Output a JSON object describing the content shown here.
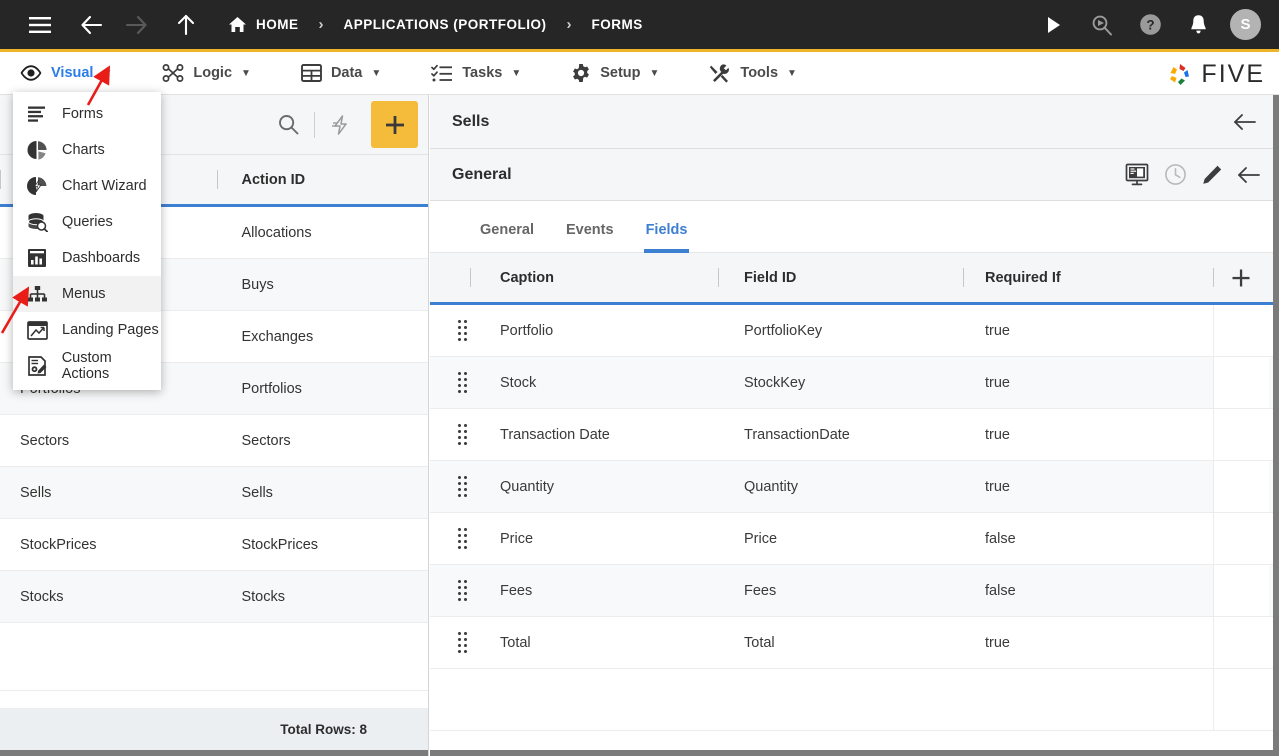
{
  "topbar": {
    "menu_icon": "hamburger-icon",
    "back_icon": "arrow-left-icon",
    "forward_icon": "arrow-right-icon",
    "up_icon": "arrow-up-icon",
    "breadcrumbs": [
      {
        "label": "HOME",
        "icon": "home-icon"
      },
      {
        "label": "APPLICATIONS (PORTFOLIO)",
        "icon": ""
      },
      {
        "label": "FORMS",
        "icon": ""
      }
    ],
    "separator": "›",
    "actions": [
      {
        "name": "run-icon",
        "label": ""
      },
      {
        "name": "search-run-icon",
        "label": ""
      },
      {
        "name": "help-icon",
        "label": ""
      },
      {
        "name": "notifications-bell-icon",
        "label": ""
      }
    ],
    "avatar_initial": "S"
  },
  "menubar": {
    "items": [
      {
        "label": "Visual",
        "icon": "eye-icon",
        "active": true
      },
      {
        "label": "Logic",
        "icon": "nodes-icon",
        "active": false
      },
      {
        "label": "Data",
        "icon": "table-icon",
        "active": false
      },
      {
        "label": "Tasks",
        "icon": "checklist-icon",
        "active": false
      },
      {
        "label": "Setup",
        "icon": "gear-icon",
        "active": false
      },
      {
        "label": "Tools",
        "icon": "tools-icon",
        "active": false
      }
    ],
    "caret": "▼",
    "logo_text": "FIVE"
  },
  "dropdown": {
    "open_for": "Visual",
    "items": [
      {
        "label": "Forms",
        "icon": "forms-icon",
        "hovered": false
      },
      {
        "label": "Charts",
        "icon": "pie-chart-icon",
        "hovered": false
      },
      {
        "label": "Chart Wizard",
        "icon": "chart-wizard-icon",
        "hovered": false
      },
      {
        "label": "Queries",
        "icon": "database-search-icon",
        "hovered": false
      },
      {
        "label": "Dashboards",
        "icon": "dashboard-icon",
        "hovered": false
      },
      {
        "label": "Menus",
        "icon": "sitemap-icon",
        "hovered": true
      },
      {
        "label": "Landing Pages",
        "icon": "landing-page-icon",
        "hovered": false
      },
      {
        "label": "Custom Actions",
        "icon": "custom-action-icon",
        "hovered": false
      }
    ]
  },
  "left_panel": {
    "toolbar": {
      "search_icon": "search-icon",
      "lightning_icon": "lightning-icon",
      "add_label": "+"
    },
    "columns": [
      "",
      "Action ID"
    ],
    "rows": [
      {
        "name": "",
        "action_id": "Allocations"
      },
      {
        "name": "",
        "action_id": "Buys"
      },
      {
        "name": "",
        "action_id": "Exchanges"
      },
      {
        "name": "Portfolios",
        "action_id": "Portfolios"
      },
      {
        "name": "Sectors",
        "action_id": "Sectors"
      },
      {
        "name": "Sells",
        "action_id": "Sells"
      },
      {
        "name": "StockPrices",
        "action_id": "StockPrices"
      },
      {
        "name": "Stocks",
        "action_id": "Stocks"
      }
    ],
    "footer": "Total Rows: 8"
  },
  "right_panel": {
    "title": "Sells",
    "back_icon": "arrow-left-icon",
    "section_title": "General",
    "section_icons": [
      {
        "name": "form-designer-icon"
      },
      {
        "name": "history-clock-icon"
      },
      {
        "name": "edit-pencil-icon"
      },
      {
        "name": "arrow-left-icon"
      }
    ],
    "tabs": [
      {
        "label": "General",
        "active": false
      },
      {
        "label": "Events",
        "active": false
      },
      {
        "label": "Fields",
        "active": true
      }
    ],
    "table": {
      "columns": [
        "",
        "Caption",
        "Field ID",
        "Required If",
        "+"
      ],
      "add_icon": "plus-icon",
      "rows": [
        {
          "caption": "Portfolio",
          "field_id": "PortfolioKey",
          "required_if": "true"
        },
        {
          "caption": "Stock",
          "field_id": "StockKey",
          "required_if": "true"
        },
        {
          "caption": "Transaction Date",
          "field_id": "TransactionDate",
          "required_if": "true"
        },
        {
          "caption": "Quantity",
          "field_id": "Quantity",
          "required_if": "true"
        },
        {
          "caption": "Price",
          "field_id": "Price",
          "required_if": "false"
        },
        {
          "caption": "Fees",
          "field_id": "Fees",
          "required_if": "false"
        },
        {
          "caption": "Total",
          "field_id": "Total",
          "required_if": "true"
        }
      ]
    }
  },
  "annotations": {
    "arrow_color": "#e81d18",
    "arrows": [
      {
        "name": "arrow-pointing-to-visual-dropdown"
      },
      {
        "name": "arrow-pointing-to-menus-item"
      }
    ]
  },
  "colors": {
    "accent_yellow": "#f0b429",
    "accent_blue": "#3d7fd1",
    "topbar_bg": "#262626",
    "panel_bg": "#f5f6f7"
  }
}
